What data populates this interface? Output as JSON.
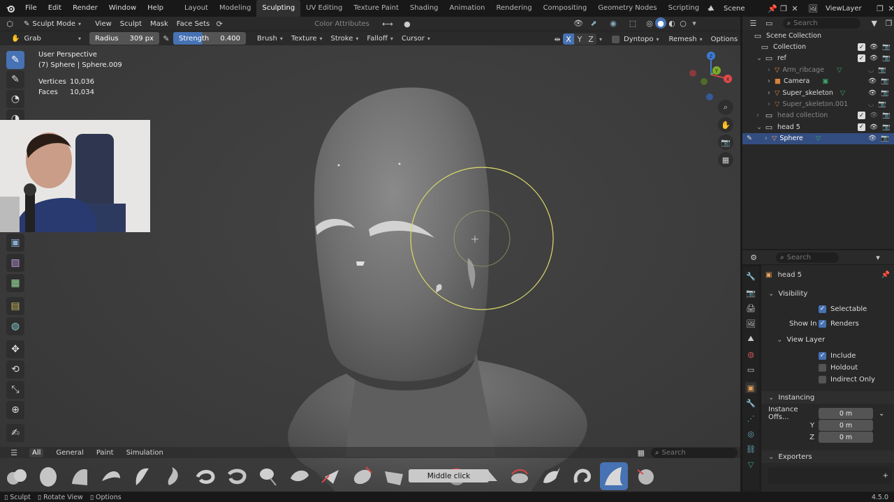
{
  "topbar": {
    "menus": [
      "File",
      "Edit",
      "Render",
      "Window",
      "Help"
    ],
    "workspaces": [
      "Layout",
      "Modeling",
      "Sculpting",
      "UV Editing",
      "Texture Paint",
      "Shading",
      "Animation",
      "Rendering",
      "Compositing",
      "Geometry Nodes",
      "Scripting"
    ],
    "active_workspace": "Sculpting",
    "scene_label": "Scene",
    "view_layer_label": "ViewLayer"
  },
  "viewport_header": {
    "mode": "Sculpt Mode",
    "menus": [
      "View",
      "Sculpt",
      "Mask",
      "Face Sets"
    ],
    "color_attributes": "Color Attributes"
  },
  "tool_settings": {
    "brush_name": "Grab",
    "radius_label": "Radius",
    "radius_value": "309 px",
    "strength_label": "Strength",
    "strength_value": "0.400",
    "dropdowns": [
      "Brush",
      "Texture",
      "Stroke",
      "Falloff",
      "Cursor"
    ],
    "axis": [
      "X",
      "Y",
      "Z"
    ],
    "dyntopo": "Dyntopo",
    "remesh": "Remesh",
    "options": "Options"
  },
  "viewport": {
    "perspective": "User Perspective",
    "object_info": "(7) Sphere | Sphere.009",
    "vertices_label": "Vertices",
    "vertices_value": "10,036",
    "faces_label": "Faces",
    "faces_value": "10,034",
    "tooltip": "Middle click",
    "gizmo_axes": [
      "X",
      "Y",
      "Z"
    ]
  },
  "brush_shelf": {
    "tabs": [
      "All",
      "General",
      "Paint",
      "Simulation"
    ],
    "active_tab": "All",
    "search_placeholder": "Search"
  },
  "outliner": {
    "search_placeholder": "Search",
    "scene_collection": "Scene Collection",
    "rows": [
      {
        "label": "Collection"
      },
      {
        "label": "ref"
      },
      {
        "label": "Arm_ribcage"
      },
      {
        "label": "Camera"
      },
      {
        "label": "Super_skeleton"
      },
      {
        "label": "Super_skeleton.001"
      },
      {
        "label": "head collection"
      },
      {
        "label": "head 5"
      },
      {
        "label": "Sphere"
      }
    ]
  },
  "properties": {
    "search_placeholder": "Search",
    "object_name": "head 5",
    "visibility": "Visibility",
    "selectable": "Selectable",
    "show_in": "Show In",
    "renders": "Renders",
    "view_layer": "View Layer",
    "include": "Include",
    "holdout": "Holdout",
    "indirect_only": "Indirect Only",
    "instancing": "Instancing",
    "instance_offset": "Instance Offs...",
    "x_value": "0 m",
    "y_label": "Y",
    "y_value": "0 m",
    "z_label": "Z",
    "z_value": "0 m",
    "exporters": "Exporters"
  },
  "status": {
    "sculpt": "Sculpt",
    "rotate_view": "Rotate View",
    "options": "Options",
    "version": "4.5.0"
  },
  "colors": {
    "accent": "#4772b3",
    "brush_circle": "#d8d86a",
    "header": "#2a2a2a",
    "background": "#1d1d1d"
  }
}
